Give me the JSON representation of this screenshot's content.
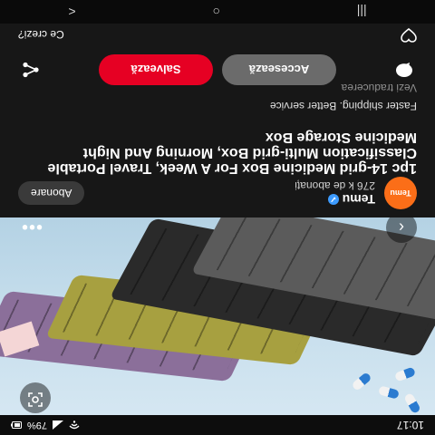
{
  "status_bar": {
    "time": "10:17",
    "battery": "79%"
  },
  "hero": {
    "image_alt": "pill-organizer-photo"
  },
  "creator": {
    "avatar_text": "Temu",
    "name": "Temu",
    "followers": "276 k de abonați",
    "follow_label": "Abonare"
  },
  "pin": {
    "title": "1pc 14-grid Medicine Box For A Week, Travel Portable Classification Multi-grid Box, Morning And Night Medicine Storage Box",
    "subtitle": "Faster shipping. Better service",
    "translate_label": "Vezi traducerea"
  },
  "actions": {
    "access_label": "Accesează",
    "save_label": "Salvează"
  },
  "comments": {
    "prompt": "Ce crezi?"
  },
  "nav": {
    "recent": "|||",
    "home": "○",
    "back": "<"
  }
}
